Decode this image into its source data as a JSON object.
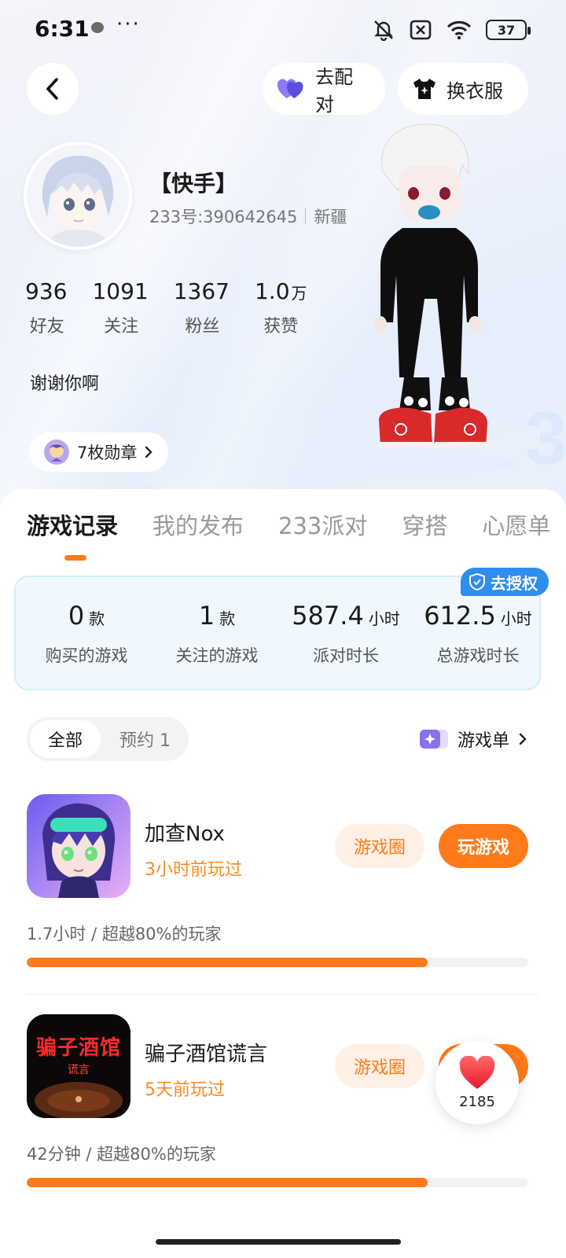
{
  "status_bar": {
    "time": "6:31",
    "dots": "···",
    "battery": "37"
  },
  "header": {
    "pair_label": "去配对",
    "dress_label": "换衣服"
  },
  "profile": {
    "nickname": "【快手】",
    "uid": "233号:390642645",
    "region": "新疆",
    "stats": [
      {
        "value": "936",
        "unit": "",
        "label": "好友"
      },
      {
        "value": "1091",
        "unit": "",
        "label": "关注"
      },
      {
        "value": "1367",
        "unit": "",
        "label": "粉丝"
      },
      {
        "value": "1.0",
        "unit": "万",
        "label": "获赞"
      }
    ],
    "bio": "谢谢你啊",
    "medals_label": "7枚勋章"
  },
  "tabs": [
    "游戏记录",
    "我的发布",
    "233派对",
    "穿搭",
    "心愿单"
  ],
  "summary": {
    "auth_label": "去授权",
    "items": [
      {
        "value": "0",
        "unit": "款",
        "label": "购买的游戏"
      },
      {
        "value": "1",
        "unit": "款",
        "label": "关注的游戏"
      },
      {
        "value": "587.4",
        "unit": "小时",
        "label": "派对时长"
      },
      {
        "value": "612.5",
        "unit": "小时",
        "label": "总游戏时长"
      }
    ]
  },
  "filters": {
    "all": "全部",
    "reserved": "预约 1",
    "game_list": "游戏单"
  },
  "games": [
    {
      "name": "加查Nox",
      "last_played": "3小时前玩过",
      "circle_label": "游戏圈",
      "play_label": "玩游戏",
      "stat": "1.7小时 / 超越80%的玩家",
      "progress": 0.8
    },
    {
      "name": "骗子酒馆谎言",
      "last_played": "5天前玩过",
      "circle_label": "游戏圈",
      "icon_title": "骗子酒馆",
      "icon_subtitle": "谎言",
      "stat": "42分钟 / 超越80%的玩家",
      "progress": 0.8
    }
  ],
  "like_fab": {
    "count": "2185"
  },
  "colors": {
    "accent": "#ff7a1a",
    "auth_blue": "#2f8cf0",
    "summary_bg": "#f1f8fd"
  }
}
